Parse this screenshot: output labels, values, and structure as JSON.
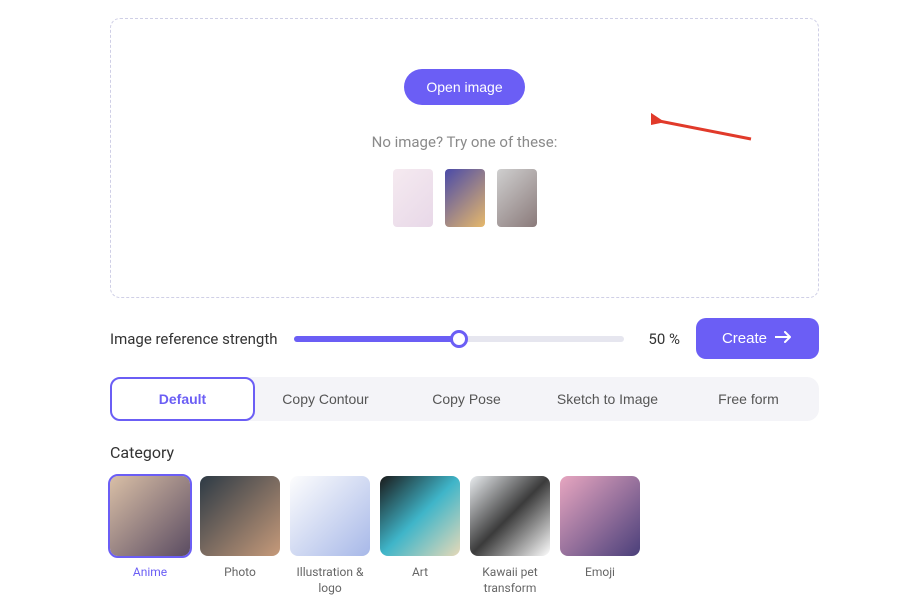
{
  "dropzone": {
    "open_label": "Open image",
    "hint": "No image? Try one of these:"
  },
  "strength": {
    "label": "Image reference strength",
    "value_text": "50 %",
    "percent": 50
  },
  "create_label": "Create",
  "tabs": [
    {
      "label": "Default",
      "active": true
    },
    {
      "label": "Copy Contour",
      "active": false
    },
    {
      "label": "Copy Pose",
      "active": false
    },
    {
      "label": "Sketch to Image",
      "active": false
    },
    {
      "label": "Free form",
      "active": false
    }
  ],
  "category_label": "Category",
  "categories": [
    {
      "label": "Anime",
      "selected": true
    },
    {
      "label": "Photo",
      "selected": false
    },
    {
      "label": "Illustration & logo",
      "selected": false
    },
    {
      "label": "Art",
      "selected": false
    },
    {
      "label": "Kawaii pet transform",
      "selected": false
    },
    {
      "label": "Emoji",
      "selected": false
    }
  ],
  "colors": {
    "accent": "#6b5ef5"
  }
}
